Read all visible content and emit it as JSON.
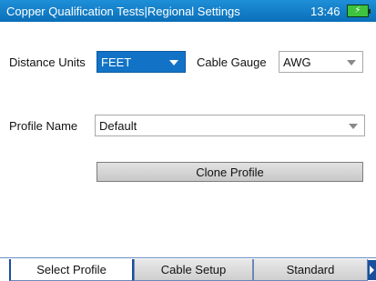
{
  "header": {
    "title": "Copper Qualification Tests|Regional Settings",
    "time": "13:46",
    "battery_icon": "battery-charging-icon"
  },
  "form": {
    "distance_units": {
      "label": "Distance Units",
      "value": "FEET"
    },
    "cable_gauge": {
      "label": "Cable Gauge",
      "value": "AWG"
    },
    "profile_name": {
      "label": "Profile Name",
      "value": "Default"
    },
    "clone_button": "Clone Profile"
  },
  "tabs": [
    {
      "label": "Select Profile",
      "selected": true
    },
    {
      "label": "Cable Setup",
      "selected": false
    },
    {
      "label": "Standard",
      "selected": false
    }
  ],
  "colors": {
    "title_bar": "#0a6fb8",
    "active_dropdown": "#1273c6",
    "tab_accent": "#1b4f9c"
  }
}
